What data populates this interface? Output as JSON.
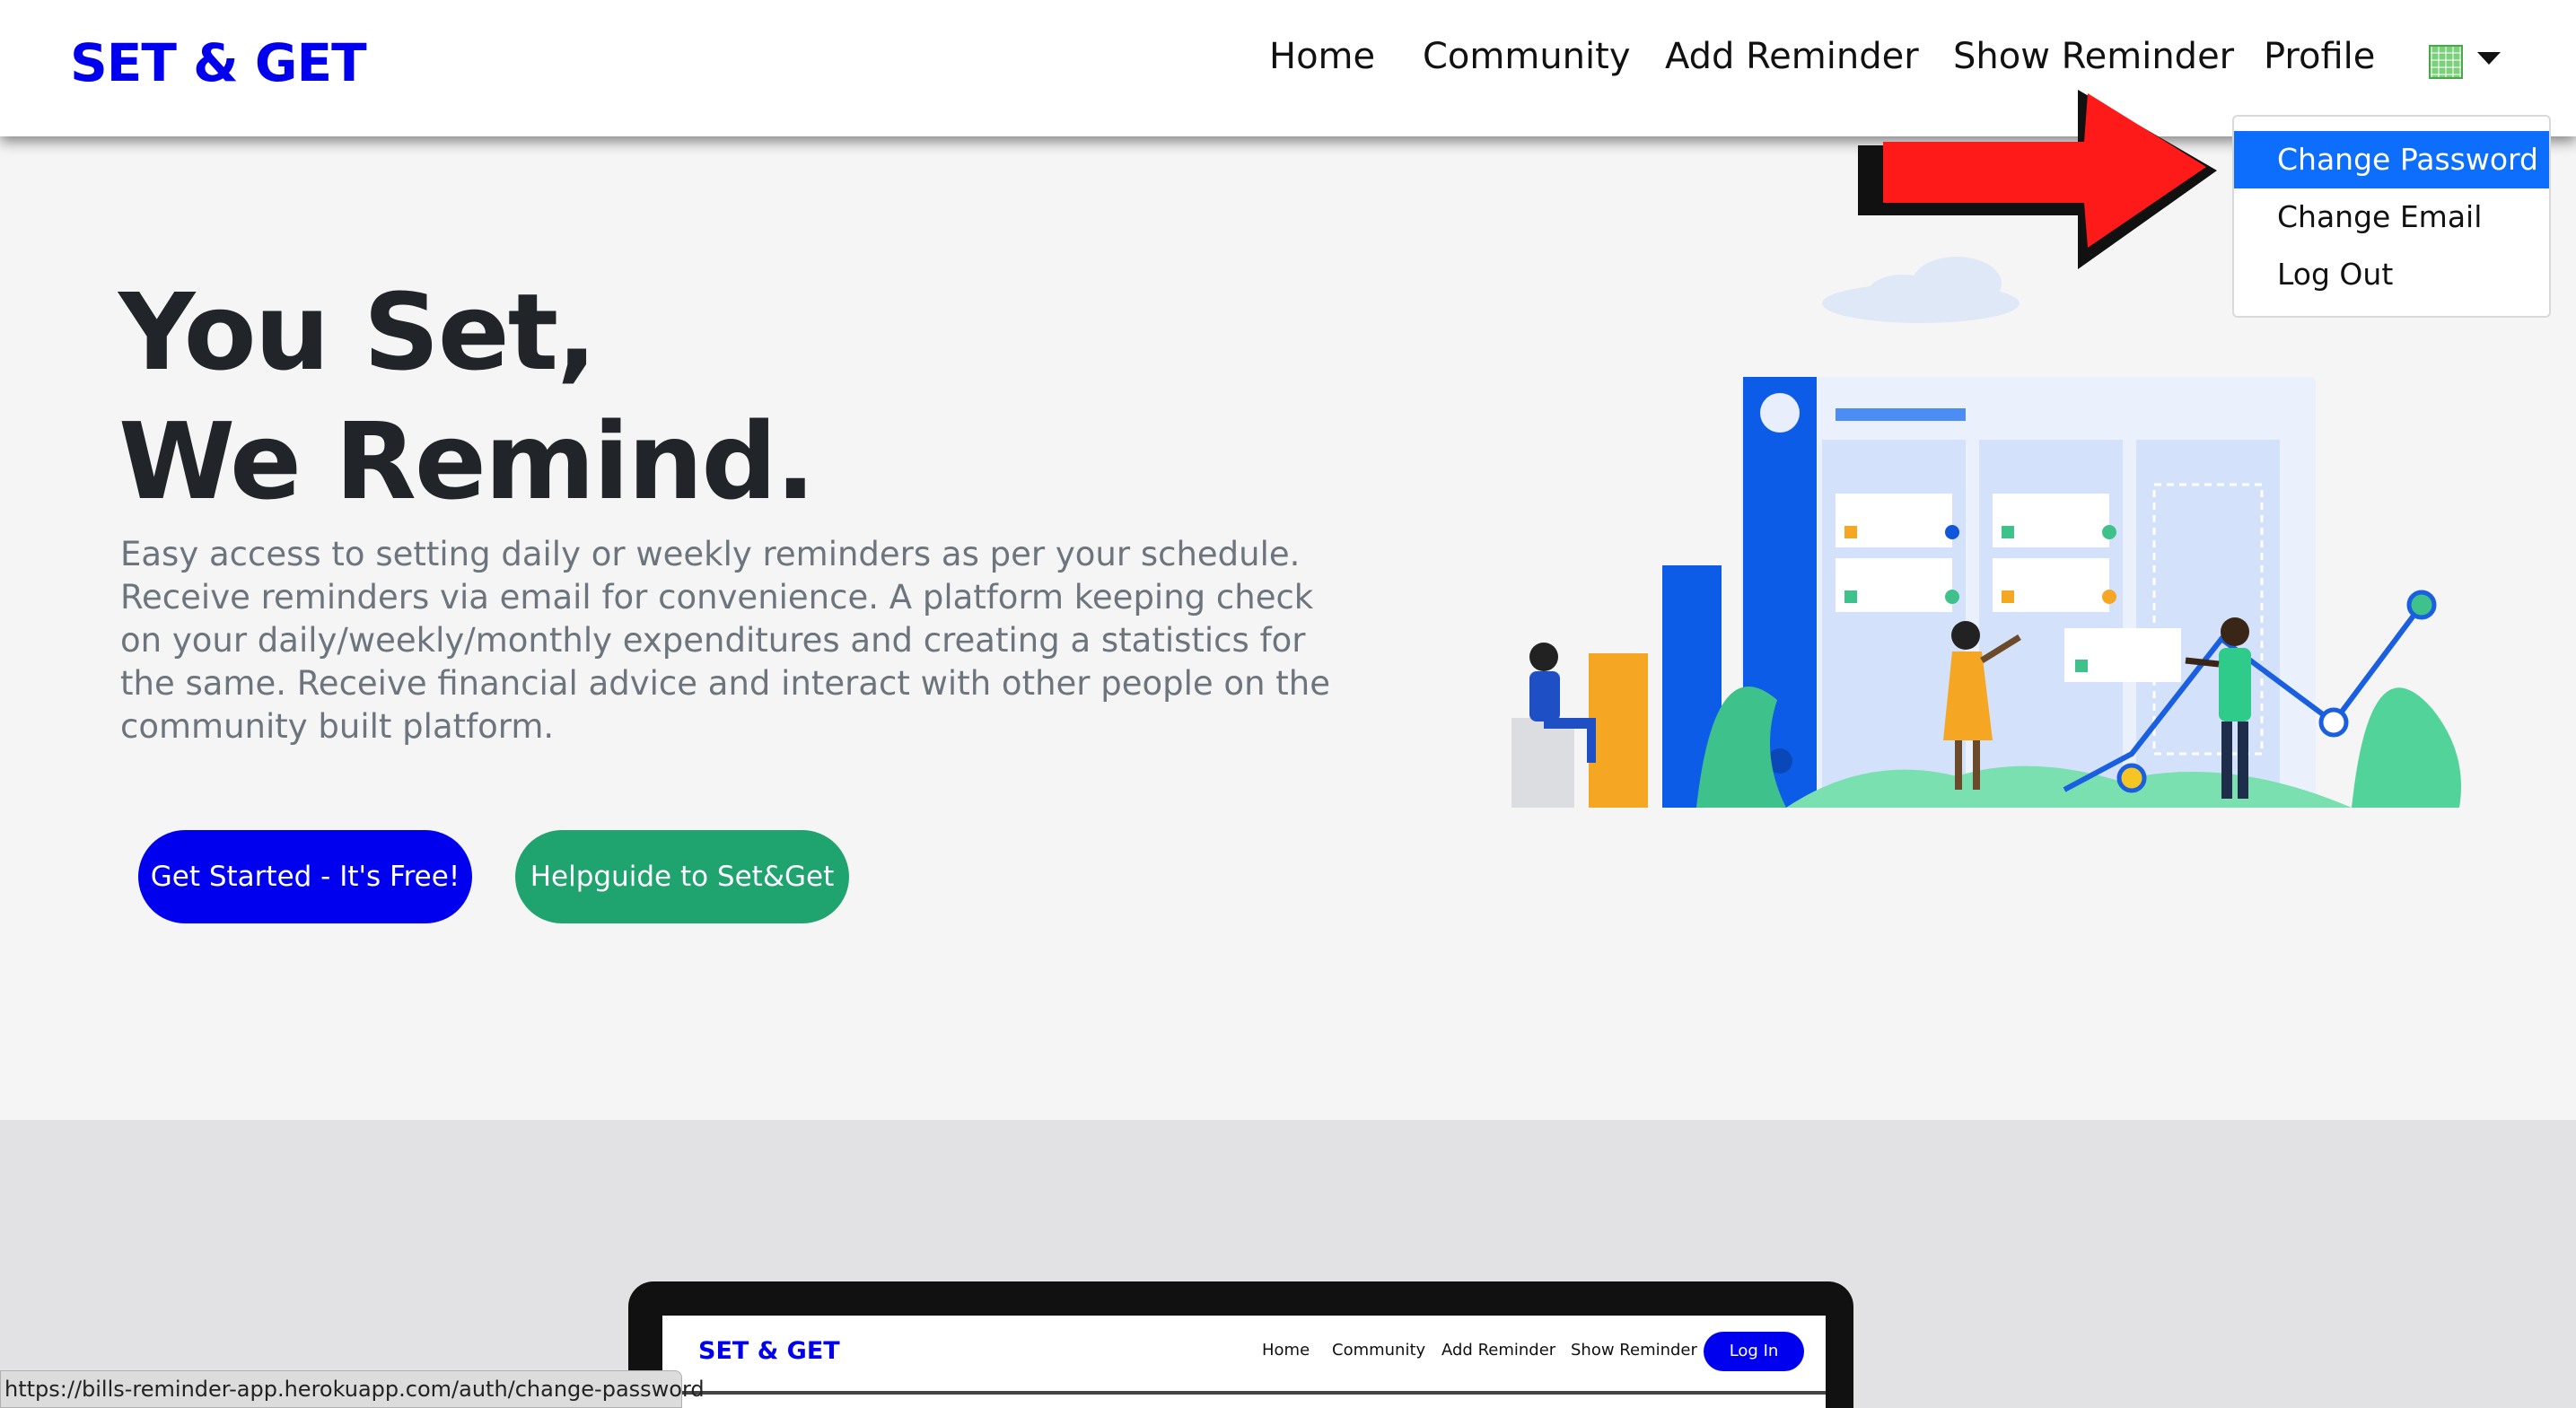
{
  "navbar": {
    "brand": "SET & GET",
    "links": [
      "Home",
      "Community",
      "Add Reminder",
      "Show Reminder",
      "Profile"
    ]
  },
  "dropdown": {
    "items": [
      "Change Password",
      "Change Email",
      "Log Out"
    ],
    "active_index": 0
  },
  "hero": {
    "title_line1": "You Set,",
    "title_line2": "We Remind.",
    "description": "Easy access to setting daily or weekly reminders as per your schedule. Receive reminders via email for convenience. A platform keeping check on your daily/weekly/monthly expenditures and creating a statistics for the same. Receive financial advice and interact with other people on the community built platform.",
    "primary_button": "Get Started - It's Free!",
    "secondary_button": "Helpguide to Set&Get"
  },
  "preview": {
    "brand": "SET & GET",
    "links": [
      "Home",
      "Community",
      "Add Reminder",
      "Show Reminder"
    ],
    "login": "Log In"
  },
  "status_bar": {
    "url": "https://bills-reminder-app.herokuapp.com/auth/change-password"
  },
  "colors": {
    "brand": "#0000ee",
    "primary_button": "#0000ee",
    "success_button": "#1fa36f",
    "dropdown_active": "#0d6efd",
    "arrow": "#ff1a1a"
  },
  "icons": [
    "avatar-icon",
    "caret-down-icon",
    "red-arrow-annotation"
  ]
}
